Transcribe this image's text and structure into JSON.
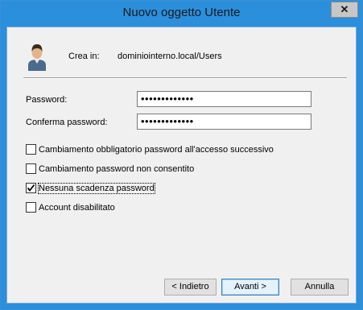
{
  "window": {
    "title": "Nuovo oggetto Utente",
    "close_glyph": "✕"
  },
  "header": {
    "create_in_label": "Crea in:",
    "create_in_value": "dominiointerno.local/Users",
    "icon": "user-icon"
  },
  "form": {
    "password_label": "Password:",
    "password_value": "•••••••••••••",
    "confirm_label": "Conferma password:",
    "confirm_value": "•••••••••••••"
  },
  "options": [
    {
      "label": "Cambiamento obbligatorio password all'accesso successivo",
      "checked": false
    },
    {
      "label": "Cambiamento password non consentito",
      "checked": false
    },
    {
      "label": "Nessuna scadenza password",
      "checked": true
    },
    {
      "label": "Account disabilitato",
      "checked": false
    }
  ],
  "buttons": {
    "back": "< Indietro",
    "next": "Avanti >",
    "cancel": "Annulla"
  }
}
